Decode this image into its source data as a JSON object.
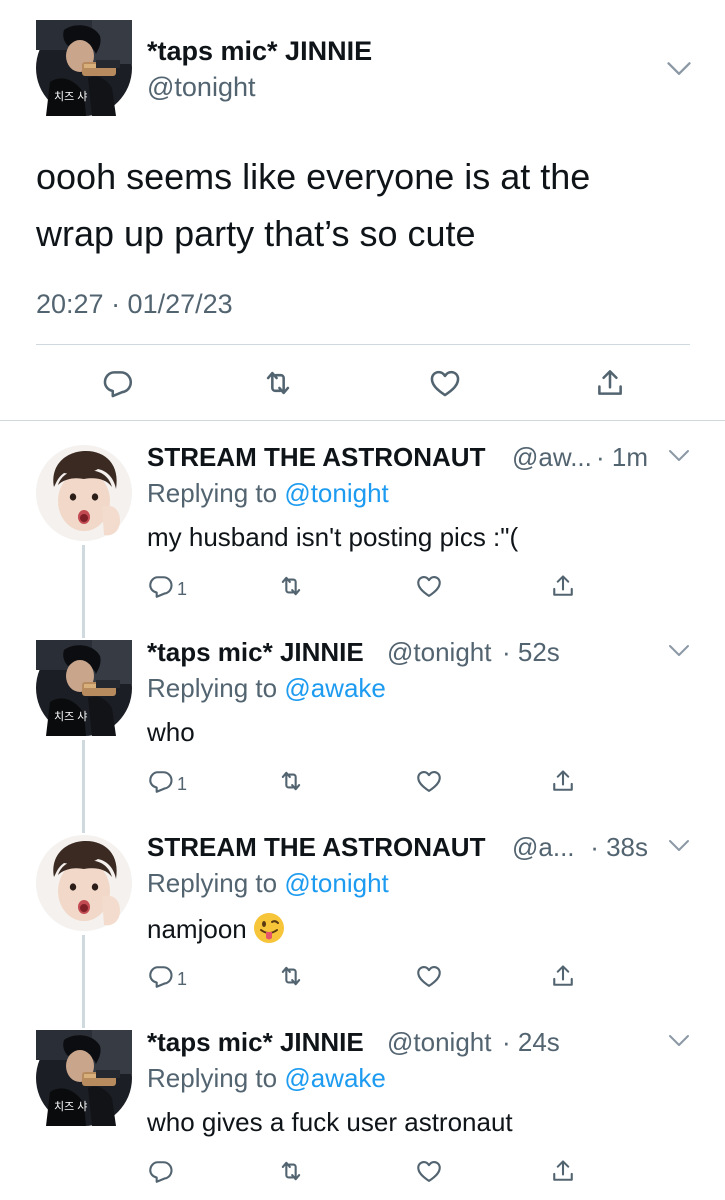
{
  "main_tweet": {
    "display_name": "*taps mic* JINNIE",
    "handle": "@tonight",
    "avatar_caption": "치즈 샤",
    "text": "oooh seems like everyone is at the\nwrap up party that’s so cute",
    "timestamp": "20:27 · 01/27/23",
    "actions": [
      "reply-icon",
      "retweet-icon",
      "like-icon",
      "share-icon"
    ]
  },
  "replies": [
    {
      "display_name": "STREAM THE ASTRONAUT",
      "handle": "@aw...",
      "time": "· 1m",
      "replying_prefix": "Replying to ",
      "replying_to": "@tonight",
      "text": "my husband isn't posting pics :\"(",
      "reply_count": "1",
      "avatar": "astronaut"
    },
    {
      "display_name": "*taps mic* JINNIE",
      "handle": "@tonight",
      "time": "· 52s",
      "replying_prefix": "Replying to ",
      "replying_to": "@awake",
      "text": "who",
      "reply_count": "1",
      "avatar": "jinnie",
      "avatar_caption": "치즈 샤"
    },
    {
      "display_name": "STREAM THE ASTRONAUT",
      "handle": "@a...",
      "time": "· 38s",
      "replying_prefix": "Replying to ",
      "replying_to": "@tonight",
      "text": "namjoon",
      "emoji": "tongue-out-face-emoji",
      "reply_count": "1",
      "avatar": "astronaut"
    },
    {
      "display_name": "*taps mic* JINNIE",
      "handle": "@tonight",
      "time": "· 24s",
      "replying_prefix": "Replying to ",
      "replying_to": "@awake",
      "text": "who gives a fuck user astronaut",
      "reply_count": "",
      "avatar": "jinnie",
      "avatar_caption": "치즈 샤"
    }
  ],
  "colors": {
    "text": "#0f1419",
    "secondary": "#536471",
    "link": "#1d9bf0",
    "divider": "#cfd9de"
  }
}
